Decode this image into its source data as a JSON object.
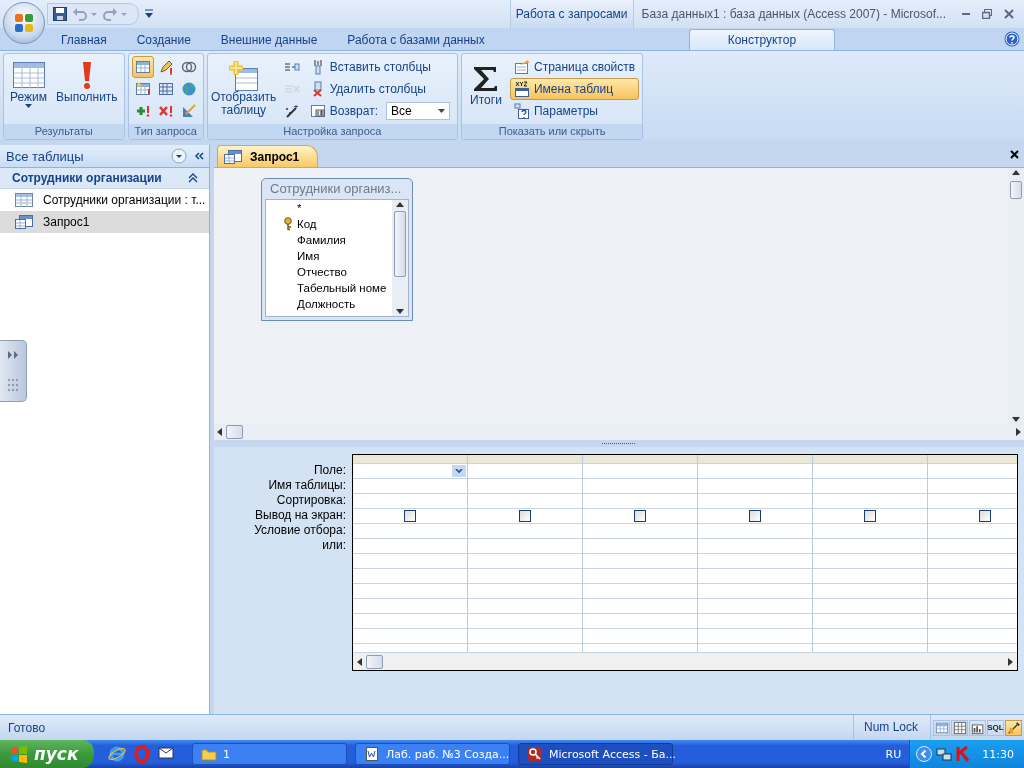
{
  "window": {
    "context_label": "Работа с запросами",
    "title": "База данных1 : база данных (Access 2007) - Microsof..."
  },
  "ribbon_tabs": [
    {
      "label": "Главная",
      "selected": false
    },
    {
      "label": "Создание",
      "selected": false
    },
    {
      "label": "Внешние данные",
      "selected": false
    },
    {
      "label": "Работа с базами данных",
      "selected": false
    },
    {
      "label": "Конструктор",
      "selected": true
    }
  ],
  "ribbon_groups": [
    {
      "label": "Результаты",
      "large": [
        {
          "kind": "view",
          "label": "Режим"
        },
        {
          "kind": "run",
          "label": "Выполнить"
        }
      ]
    },
    {
      "label": "Тип запроса",
      "icons": [
        {
          "kind": "select",
          "selected": true
        },
        {
          "kind": "update",
          "selected": false
        },
        {
          "kind": "union",
          "selected": false
        },
        {
          "kind": "make-table",
          "selected": false
        },
        {
          "kind": "crosstab",
          "selected": false
        },
        {
          "kind": "pass-through",
          "selected": false
        },
        {
          "kind": "append",
          "selected": false
        },
        {
          "kind": "delete",
          "selected": false
        },
        {
          "kind": "data-definition",
          "selected": false
        }
      ]
    },
    {
      "label": "Настройка запроса",
      "large": [
        {
          "kind": "show-table",
          "label": "Отобразить таблицу"
        }
      ],
      "small": [
        {
          "kind": "insert-rows",
          "disabled": false
        },
        {
          "kind": "delete-rows",
          "disabled": true
        },
        {
          "kind": "builder",
          "disabled": false
        },
        {
          "kind": "insert-columns",
          "label": "Вставить столбцы",
          "disabled": false
        },
        {
          "kind": "delete-columns",
          "label": "Удалить столбцы",
          "disabled": false
        },
        {
          "kind": "return",
          "label": "Возврат:",
          "value": "Все",
          "disabled": false
        }
      ]
    },
    {
      "label": "Показать или скрыть",
      "large": [
        {
          "kind": "totals",
          "label": "Итоги"
        }
      ],
      "small": [
        {
          "kind": "property-sheet",
          "label": "Страница свойств",
          "selected": false
        },
        {
          "kind": "table-names",
          "label": "Имена таблиц",
          "selected": true
        },
        {
          "kind": "parameters",
          "label": "Параметры",
          "selected": false
        }
      ]
    }
  ],
  "navigation": {
    "header": "Все таблицы",
    "group": {
      "label": "Сотрудники организации",
      "expanded": true
    },
    "items": [
      {
        "kind": "table",
        "label": "Сотрудники организации : т...",
        "selected": false
      },
      {
        "kind": "query",
        "label": "Запрос1",
        "selected": true
      }
    ]
  },
  "document_tab": {
    "label": "Запрос1"
  },
  "table_box": {
    "title": "Сотрудники организ...",
    "fields": [
      {
        "name": "*",
        "key": false
      },
      {
        "name": "Код",
        "key": true
      },
      {
        "name": "Фамилия",
        "key": false
      },
      {
        "name": "Имя",
        "key": false
      },
      {
        "name": "Отчество",
        "key": false
      },
      {
        "name": "Табельный номе",
        "key": false
      },
      {
        "name": "Должность",
        "key": false
      }
    ]
  },
  "grid": {
    "row_labels": [
      "Поле:",
      "Имя таблицы:",
      "Сортировка:",
      "Вывод на экран:",
      "Условие отбора:",
      "или:"
    ],
    "columns": [
      {
        "show": false
      },
      {
        "show": false
      },
      {
        "show": false
      },
      {
        "show": false
      },
      {
        "show": false
      },
      {
        "show": false
      }
    ]
  },
  "status_bar": {
    "text": "Готово",
    "indicator": "Num Lock",
    "views": [
      {
        "kind": "datasheet",
        "selected": false
      },
      {
        "kind": "pivot-table",
        "selected": false
      },
      {
        "kind": "pivot-chart",
        "selected": false
      },
      {
        "kind": "sql",
        "label": "SQL",
        "selected": false
      },
      {
        "kind": "design",
        "selected": true
      }
    ]
  },
  "taskbar": {
    "start": "пуск",
    "tasks": [
      {
        "kind": "folder",
        "label": "1",
        "selected": false
      },
      {
        "kind": "word",
        "label": "Лаб. раб. №3 Созда...",
        "selected": false
      },
      {
        "kind": "access",
        "label": "Microsoft Access - Ба...",
        "selected": true
      }
    ],
    "language": "RU",
    "clock": "11:30"
  }
}
